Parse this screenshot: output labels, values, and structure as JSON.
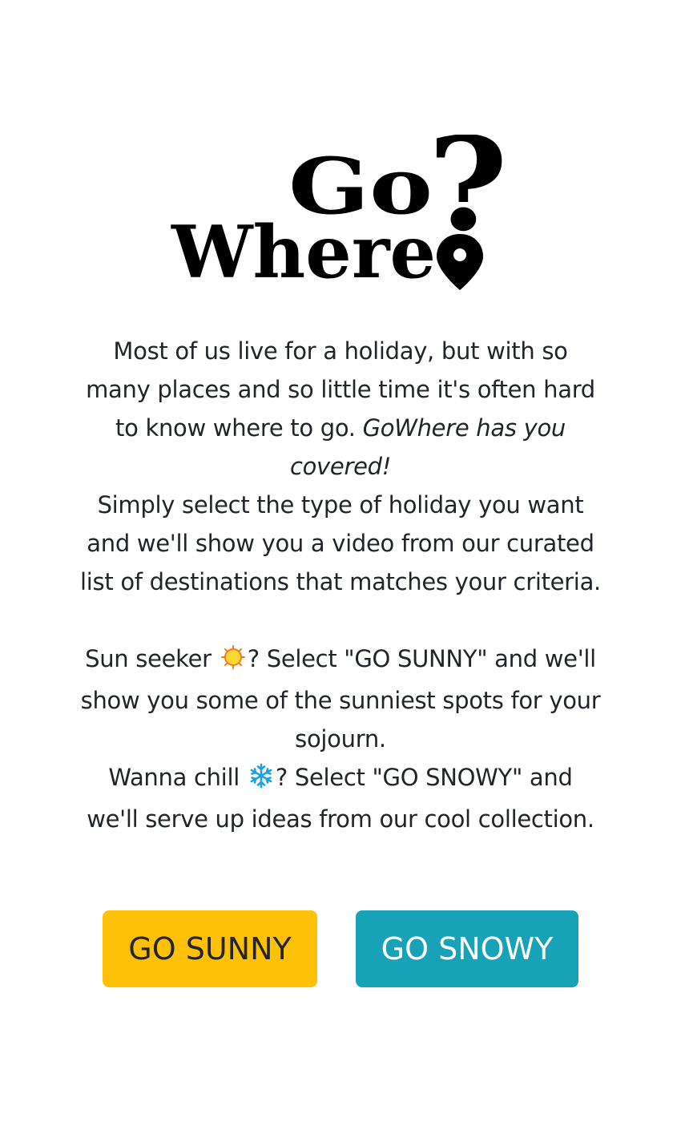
{
  "logo": {
    "word_top": "Go",
    "word_bottom": "Where",
    "question_mark": "?",
    "pin_icon": "map-pin-icon"
  },
  "intro": {
    "p1_plain": "Most of us live for a holiday, but with so many places and so little time it's often hard to know where to go. ",
    "p1_italic": "GoWhere has you covered!",
    "p2": "Simply select the type of holiday you want and we'll show you a video from our curated list of destinations that matches your criteria.",
    "sunny_prefix": "Sun seeker ",
    "sunny_icon": "sun-icon",
    "sunny_suffix": "? Select \"GO SUNNY\" and we'll show you some of the sunniest spots for your sojourn.",
    "snowy_prefix": "Wanna chill ",
    "snowy_icon": "snowflake-icon",
    "snowy_suffix": "? Select \"GO SNOWY\" and we'll serve up ideas from our cool collection."
  },
  "buttons": {
    "sunny_label": "GO SUNNY",
    "snowy_label": "GO SNOWY"
  },
  "colors": {
    "sunny_button": "#ffc107",
    "snowy_button": "#17a2b8",
    "text": "#212529",
    "background": "#ffffff"
  }
}
